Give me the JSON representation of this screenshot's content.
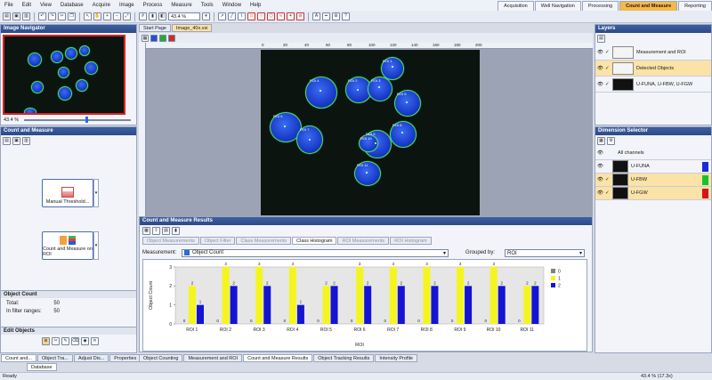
{
  "menu": [
    "File",
    "Edit",
    "View",
    "Database",
    "Acquire",
    "Image",
    "Process",
    "Measure",
    "Tools",
    "Window",
    "Help"
  ],
  "layout_tabs": [
    {
      "label": "Acquisition",
      "active": false
    },
    {
      "label": "Well Navigation",
      "active": false
    },
    {
      "label": "Processing",
      "active": false
    },
    {
      "label": "Count and Measure",
      "active": true
    },
    {
      "label": "Reporting",
      "active": false
    }
  ],
  "toolbar": {
    "zoom": "43.4 %"
  },
  "image_navigator": {
    "title": "Image Navigator",
    "zoom": "43.4 %"
  },
  "count_measure_panel": {
    "title": "Count and Measure",
    "step1_number": "1",
    "step1_label": "Manual Threshold...",
    "step2_number": "2",
    "step2_label": "Count and Measure on ROI",
    "object_count_title": "Object Count",
    "total_label": "Total:",
    "total_value": "50",
    "in_filter_label": "In filter ranges:",
    "in_filter_value": "50",
    "edit_objects_title": "Edit Objects"
  },
  "doc_tabs": [
    {
      "label": "Start Page",
      "active": false
    },
    {
      "label": "Image_40x.vsi",
      "active": true
    }
  ],
  "ruler_labels": [
    "0",
    "20",
    "40",
    "60",
    "80",
    "100",
    "120",
    "140",
    "160",
    "180",
    "200"
  ],
  "roi_labels": [
    "ROI 1",
    "ROI 2",
    "ROI 3",
    "ROI 4",
    "ROI 5",
    "ROI 6",
    "ROI 7",
    "ROI 8",
    "ROI 9",
    "ROI 10",
    "ROI 11"
  ],
  "results": {
    "title": "Count and Measure Results",
    "tabs": [
      {
        "label": "Object Measurements",
        "active": false
      },
      {
        "label": "Object Filter",
        "active": false
      },
      {
        "label": "Class Measurements",
        "active": false
      },
      {
        "label": "Class Histogram",
        "active": true
      },
      {
        "label": "ROI Measurements",
        "active": false
      },
      {
        "label": "ROI Histogram",
        "active": false
      }
    ],
    "measurement_label": "Measurement:",
    "measurement_value": "Object Count",
    "grouped_label": "Grouped by:",
    "grouped_value": "ROI"
  },
  "chart_data": {
    "type": "bar",
    "categories": [
      "ROI 1",
      "ROI 2",
      "ROI 3",
      "ROI 4",
      "ROI 5",
      "ROI 6",
      "ROI 7",
      "ROI 8",
      "ROI 9",
      "ROI 10",
      "ROI 11"
    ],
    "series": [
      {
        "name": "0",
        "color": "#808080",
        "values": [
          0,
          0,
          0,
          0,
          0,
          0,
          0,
          0,
          0,
          0,
          0
        ]
      },
      {
        "name": "1",
        "color": "#f5f51e",
        "values": [
          2,
          3,
          3,
          3,
          2,
          3,
          3,
          3,
          3,
          3,
          2
        ]
      },
      {
        "name": "2",
        "color": "#1414d2",
        "values": [
          1,
          2,
          2,
          1,
          2,
          2,
          2,
          2,
          2,
          2,
          2
        ]
      }
    ],
    "xlabel": "ROI",
    "ylabel": "Object Count",
    "yticks": [
      "0",
      "1",
      "2",
      "3"
    ],
    "ylim": [
      0,
      3
    ],
    "legend": "top-right"
  },
  "bottom_tabs_left": [
    "Count and...",
    "Object Tra...",
    "Adjust Dis...",
    "Properties"
  ],
  "bottom_tabs_center": [
    "Object Counting",
    "Measurement and ROI",
    "Count and Measure Results",
    "Object Tracking Results",
    "Intensity Profile"
  ],
  "database_tab": "Database",
  "status": {
    "left": "Ready",
    "right": "43.4 % (17.3x)"
  },
  "layers": {
    "title": "Layers",
    "items": [
      {
        "label": "Measurement and ROI",
        "selected": false
      },
      {
        "label": "Detected Objects",
        "selected": true
      },
      {
        "label": "U-FUNA, U-FBW, U-FGW",
        "selected": false
      }
    ]
  },
  "dimension_selector": {
    "title": "Dimension Selector",
    "all_channels": "All channels",
    "channels": [
      {
        "label": "U-FUNA",
        "color": "#1a2bd8",
        "selected": false
      },
      {
        "label": "U-FBW",
        "color": "#17c12d",
        "selected": true
      },
      {
        "label": "U-FGW",
        "color": "#d11717",
        "selected": true
      }
    ]
  },
  "accent": "#f5b84a"
}
